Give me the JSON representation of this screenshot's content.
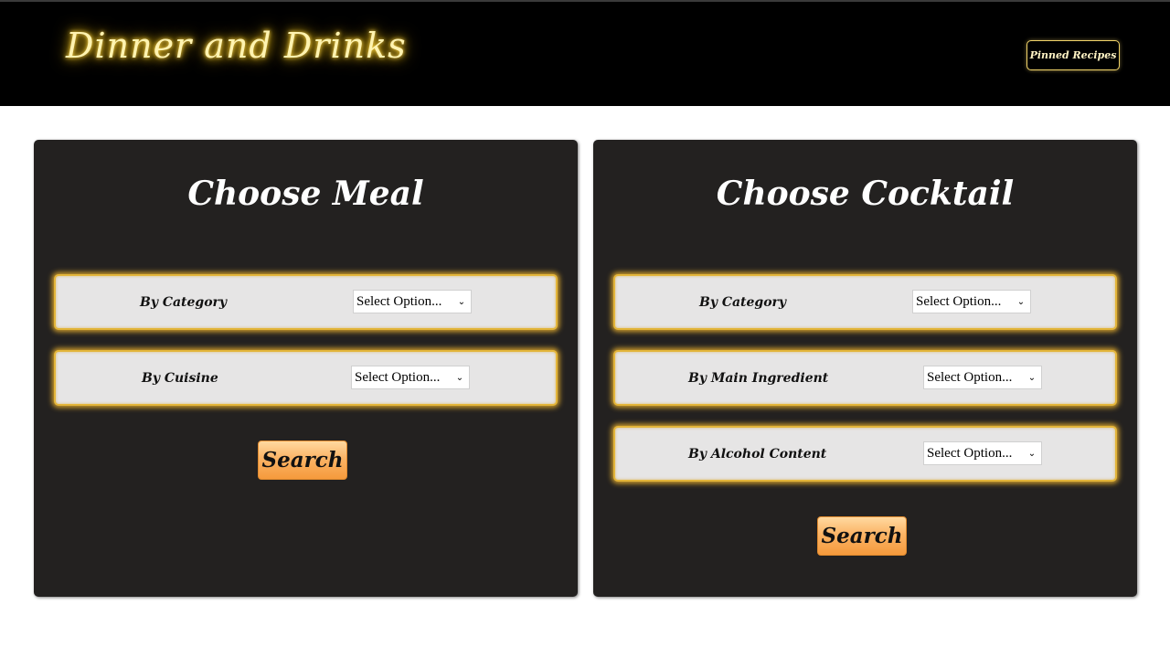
{
  "header": {
    "logo_text": "Dinner and Drinks",
    "pinned_label": "Pinned Recipes"
  },
  "meal": {
    "title": "Choose Meal",
    "filters": [
      {
        "label": "By Category",
        "value": "Select Option..."
      },
      {
        "label": "By Cuisine",
        "value": "Select Option..."
      }
    ],
    "search_label": "Search"
  },
  "cocktail": {
    "title": "Choose Cocktail",
    "filters": [
      {
        "label": "By Category",
        "value": "Select Option..."
      },
      {
        "label": "By Main Ingredient",
        "value": "Select Option..."
      },
      {
        "label": "By Alcohol Content",
        "value": "Select Option..."
      }
    ],
    "search_label": "Search"
  },
  "icons": {
    "select_chevron": "chevron-down-icon"
  },
  "colors": {
    "header_bg": "#000000",
    "logo_glow": "#f5c518",
    "panel_bg": "#232120",
    "row_bg": "#e6e5e5",
    "row_glow": "#d4a12c",
    "search_btn": "#fbb466"
  }
}
